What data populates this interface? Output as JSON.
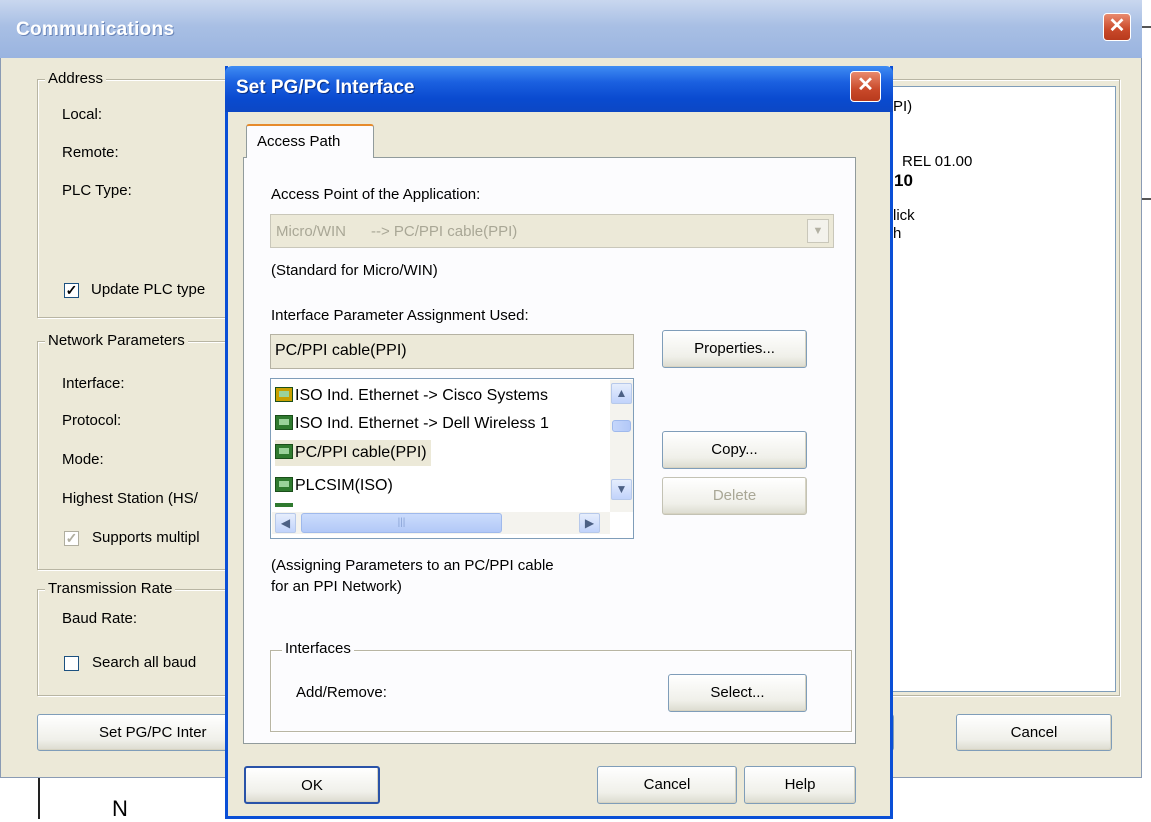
{
  "comm": {
    "title": "Communications",
    "address": {
      "title": "Address",
      "local": "Local:",
      "remote": "Remote:",
      "plc_type": "PLC Type:",
      "update_chk": "Update PLC type"
    },
    "network": {
      "title": "Network Parameters",
      "interface": "Interface:",
      "protocol": "Protocol:",
      "mode": "Mode:",
      "highest": "Highest Station (HS/",
      "supports": "Supports multipl"
    },
    "transmission": {
      "title": "Transmission Rate",
      "baud": "Baud Rate:",
      "search": "Search all baud"
    },
    "right_panel": {
      "line1": "PI)",
      "line2": "REL 01.00",
      "line3": "10",
      "line4": "lick",
      "line5": "h"
    },
    "set_pgpc_btn": "Set PG/PC Inter",
    "cancel_btn": "Cancel",
    "below_text": "N"
  },
  "dialog": {
    "title": "Set PG/PC Interface",
    "tab": "Access Path",
    "access_point_label": "Access Point of the Application:",
    "access_point_value": "Micro/WIN      --> PC/PPI cable(PPI)",
    "standard_text": "(Standard for Micro/WIN)",
    "iface_param_label": "Interface Parameter Assignment Used:",
    "iface_param_value": "PC/PPI cable(PPI)",
    "properties_btn": "Properties...",
    "list": [
      "ISO Ind. Ethernet -> Cisco Systems",
      "ISO Ind. Ethernet -> Dell Wireless 1",
      "PC/PPI cable(PPI)",
      "PLCSIM(ISO)"
    ],
    "copy_btn": "Copy...",
    "delete_btn": "Delete",
    "desc_line1": "(Assigning Parameters to an PC/PPI cable",
    "desc_line2": "for an PPI Network)",
    "interfaces_title": "Interfaces",
    "add_remove": "Add/Remove:",
    "select_btn": "Select...",
    "ok_btn": "OK",
    "cancel_btn": "Cancel",
    "help_btn": "Help"
  }
}
